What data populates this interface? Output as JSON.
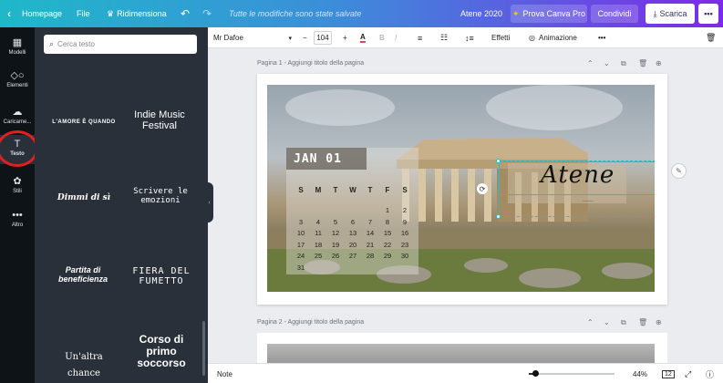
{
  "topbar": {
    "home_label": "Homepage",
    "file_label": "File",
    "resize_label": "Ridimensiona",
    "saved_status": "Tutte le modifiche sono state salvate",
    "doc_title": "Atene 2020",
    "pro_label": "Prova Canva Pro",
    "share_label": "Condividi",
    "download_label": "Scarica"
  },
  "sidebar": {
    "items": [
      {
        "label": "Modelli",
        "icon": "layout-icon"
      },
      {
        "label": "Elementi",
        "icon": "shapes-icon"
      },
      {
        "label": "Caricame...",
        "icon": "upload-icon"
      },
      {
        "label": "Testo",
        "icon": "text-icon"
      },
      {
        "label": "Stili",
        "icon": "palette-icon"
      },
      {
        "label": "Altro",
        "icon": "more-dots-icon"
      }
    ]
  },
  "panel": {
    "search_placeholder": "Cerca testo",
    "templates": [
      {
        "title": "L'AMORE È QUANDO"
      },
      {
        "title": "Indie Music Festival"
      },
      {
        "title": "Dimmi di sì"
      },
      {
        "title": "Scrivere le emozioni"
      },
      {
        "title": "Partita di beneficienza"
      },
      {
        "title": "FIERA DEL FUMETTO"
      },
      {
        "title": "Un'altra chance"
      },
      {
        "title": "Corso di primo soccorso"
      }
    ]
  },
  "format": {
    "font_name": "Mr Dafoe",
    "minus": "−",
    "font_size": "104",
    "plus": "+",
    "bold": "B",
    "italic": "I",
    "effects_label": "Effetti",
    "animation_label": "Animazione"
  },
  "pages": {
    "page1_label": "Pagina 1 - Aggiungi titolo della pagina",
    "page2_label": "Pagina 2 - Aggiungi titolo della pagina"
  },
  "calendar": {
    "month": "JAN 01",
    "days": [
      "S",
      "M",
      "T",
      "W",
      "T",
      "F",
      "S"
    ],
    "weeks": [
      [
        "",
        "",
        "",
        "",
        "",
        "1",
        "2"
      ],
      [
        "3",
        "4",
        "5",
        "6",
        "7",
        "8",
        "9"
      ],
      [
        "10",
        "11",
        "12",
        "13",
        "14",
        "15",
        "16"
      ],
      [
        "17",
        "18",
        "19",
        "20",
        "21",
        "22",
        "23"
      ],
      [
        "24",
        "25",
        "26",
        "27",
        "28",
        "29",
        "30"
      ],
      [
        "31",
        "",
        "",
        "",
        "",
        "",
        ""
      ]
    ]
  },
  "design": {
    "title": "Atene"
  },
  "bottombar": {
    "notes_label": "Note",
    "zoom_label": "44%",
    "zoom_value": 0.07,
    "page_count": "12"
  }
}
